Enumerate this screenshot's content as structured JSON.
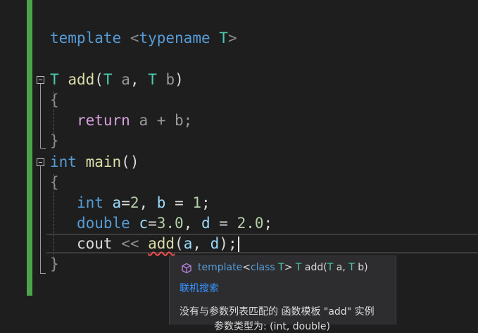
{
  "code": {
    "line1": {
      "kw_template": "template",
      "lt": "<",
      "kw_typename": "typename",
      "space": " ",
      "type_T": "T",
      "gt": ">"
    },
    "line2": {
      "ret_type": "T",
      "fn": "add",
      "open": "(",
      "p1_type": "T",
      "p1_name": "a",
      "comma": ",",
      "p2_type": "T",
      "p2_name": "b",
      "close": ")"
    },
    "line3": {
      "brace": "{"
    },
    "line4": {
      "kw_return": "return",
      "expr": "a + b;"
    },
    "line5": {
      "brace": "}"
    },
    "line6": {
      "kw_int": "int",
      "fn": "main",
      "parens": "()"
    },
    "line7": {
      "brace": "{"
    },
    "line8": {
      "kw_int": "int",
      "var_a": "a",
      "eq1": "=",
      "num_2": "2",
      "comma": ", ",
      "var_b": "b",
      "eq2": " = ",
      "num_1": "1",
      "semi": ";"
    },
    "line9": {
      "kw_double": "double",
      "var_c": "c",
      "eq1": "=",
      "num_3": "3.0",
      "comma": ", ",
      "var_d": "d",
      "eq2": " = ",
      "num_2": "2.0",
      "semi": ";"
    },
    "line10": {
      "var_cout": "cout",
      "op": " << ",
      "fn": "add",
      "open": "(",
      "arg1": "a",
      "comma": ", ",
      "arg2": "d",
      "close": ");"
    },
    "line11": {
      "brace": "}"
    }
  },
  "tooltip": {
    "icon": "template-cube-icon",
    "sig_kw": "template",
    "sig_lt": "<",
    "sig_class": "class",
    "sig_T": "T",
    "sig_gt": ">",
    "sig_rest_type": "T",
    "sig_fn": "add",
    "sig_open": "(",
    "sig_p1_type": "T",
    "sig_p1_name": "a,",
    "sig_p2_type": "T",
    "sig_p2_name": "b)",
    "link": "联机搜索",
    "message_line1": "没有与参数列表匹配的 函数模板 \"add\" 实例",
    "message_line2": "参数类型为: (int, double)"
  },
  "colors": {
    "background": "#1e1e1e",
    "change_bar": "#4ea44a",
    "keyword": "#569cd6",
    "type": "#4ec9b0",
    "function": "#dcdcaa",
    "variable": "#9cdcfe",
    "number": "#b5cea8",
    "control_keyword": "#d8a0df",
    "error_squiggle": "#f14c4c"
  }
}
